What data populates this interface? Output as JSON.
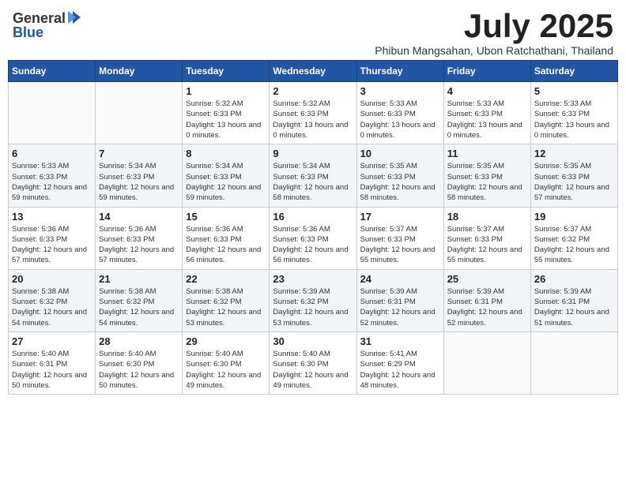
{
  "header": {
    "logo_general": "General",
    "logo_blue": "Blue",
    "month_title": "July 2025",
    "subtitle": "Phibun Mangsahan, Ubon Ratchathani, Thailand"
  },
  "days_of_week": [
    "Sunday",
    "Monday",
    "Tuesday",
    "Wednesday",
    "Thursday",
    "Friday",
    "Saturday"
  ],
  "weeks": [
    {
      "days": [
        {
          "num": "",
          "info": ""
        },
        {
          "num": "",
          "info": ""
        },
        {
          "num": "1",
          "info": "Sunrise: 5:32 AM\nSunset: 6:33 PM\nDaylight: 13 hours and 0 minutes."
        },
        {
          "num": "2",
          "info": "Sunrise: 5:32 AM\nSunset: 6:33 PM\nDaylight: 13 hours and 0 minutes."
        },
        {
          "num": "3",
          "info": "Sunrise: 5:33 AM\nSunset: 6:33 PM\nDaylight: 13 hours and 0 minutes."
        },
        {
          "num": "4",
          "info": "Sunrise: 5:33 AM\nSunset: 6:33 PM\nDaylight: 13 hours and 0 minutes."
        },
        {
          "num": "5",
          "info": "Sunrise: 5:33 AM\nSunset: 6:33 PM\nDaylight: 13 hours and 0 minutes."
        }
      ]
    },
    {
      "days": [
        {
          "num": "6",
          "info": "Sunrise: 5:33 AM\nSunset: 6:33 PM\nDaylight: 12 hours and 59 minutes."
        },
        {
          "num": "7",
          "info": "Sunrise: 5:34 AM\nSunset: 6:33 PM\nDaylight: 12 hours and 59 minutes."
        },
        {
          "num": "8",
          "info": "Sunrise: 5:34 AM\nSunset: 6:33 PM\nDaylight: 12 hours and 59 minutes."
        },
        {
          "num": "9",
          "info": "Sunrise: 5:34 AM\nSunset: 6:33 PM\nDaylight: 12 hours and 58 minutes."
        },
        {
          "num": "10",
          "info": "Sunrise: 5:35 AM\nSunset: 6:33 PM\nDaylight: 12 hours and 58 minutes."
        },
        {
          "num": "11",
          "info": "Sunrise: 5:35 AM\nSunset: 6:33 PM\nDaylight: 12 hours and 58 minutes."
        },
        {
          "num": "12",
          "info": "Sunrise: 5:35 AM\nSunset: 6:33 PM\nDaylight: 12 hours and 57 minutes."
        }
      ]
    },
    {
      "days": [
        {
          "num": "13",
          "info": "Sunrise: 5:36 AM\nSunset: 6:33 PM\nDaylight: 12 hours and 57 minutes."
        },
        {
          "num": "14",
          "info": "Sunrise: 5:36 AM\nSunset: 6:33 PM\nDaylight: 12 hours and 57 minutes."
        },
        {
          "num": "15",
          "info": "Sunrise: 5:36 AM\nSunset: 6:33 PM\nDaylight: 12 hours and 56 minutes."
        },
        {
          "num": "16",
          "info": "Sunrise: 5:36 AM\nSunset: 6:33 PM\nDaylight: 12 hours and 56 minutes."
        },
        {
          "num": "17",
          "info": "Sunrise: 5:37 AM\nSunset: 6:33 PM\nDaylight: 12 hours and 55 minutes."
        },
        {
          "num": "18",
          "info": "Sunrise: 5:37 AM\nSunset: 6:33 PM\nDaylight: 12 hours and 55 minutes."
        },
        {
          "num": "19",
          "info": "Sunrise: 5:37 AM\nSunset: 6:32 PM\nDaylight: 12 hours and 55 minutes."
        }
      ]
    },
    {
      "days": [
        {
          "num": "20",
          "info": "Sunrise: 5:38 AM\nSunset: 6:32 PM\nDaylight: 12 hours and 54 minutes."
        },
        {
          "num": "21",
          "info": "Sunrise: 5:38 AM\nSunset: 6:32 PM\nDaylight: 12 hours and 54 minutes."
        },
        {
          "num": "22",
          "info": "Sunrise: 5:38 AM\nSunset: 6:32 PM\nDaylight: 12 hours and 53 minutes."
        },
        {
          "num": "23",
          "info": "Sunrise: 5:39 AM\nSunset: 6:32 PM\nDaylight: 12 hours and 53 minutes."
        },
        {
          "num": "24",
          "info": "Sunrise: 5:39 AM\nSunset: 6:31 PM\nDaylight: 12 hours and 52 minutes."
        },
        {
          "num": "25",
          "info": "Sunrise: 5:39 AM\nSunset: 6:31 PM\nDaylight: 12 hours and 52 minutes."
        },
        {
          "num": "26",
          "info": "Sunrise: 5:39 AM\nSunset: 6:31 PM\nDaylight: 12 hours and 51 minutes."
        }
      ]
    },
    {
      "days": [
        {
          "num": "27",
          "info": "Sunrise: 5:40 AM\nSunset: 6:31 PM\nDaylight: 12 hours and 50 minutes."
        },
        {
          "num": "28",
          "info": "Sunrise: 5:40 AM\nSunset: 6:30 PM\nDaylight: 12 hours and 50 minutes."
        },
        {
          "num": "29",
          "info": "Sunrise: 5:40 AM\nSunset: 6:30 PM\nDaylight: 12 hours and 49 minutes."
        },
        {
          "num": "30",
          "info": "Sunrise: 5:40 AM\nSunset: 6:30 PM\nDaylight: 12 hours and 49 minutes."
        },
        {
          "num": "31",
          "info": "Sunrise: 5:41 AM\nSunset: 6:29 PM\nDaylight: 12 hours and 48 minutes."
        },
        {
          "num": "",
          "info": ""
        },
        {
          "num": "",
          "info": ""
        }
      ]
    }
  ]
}
